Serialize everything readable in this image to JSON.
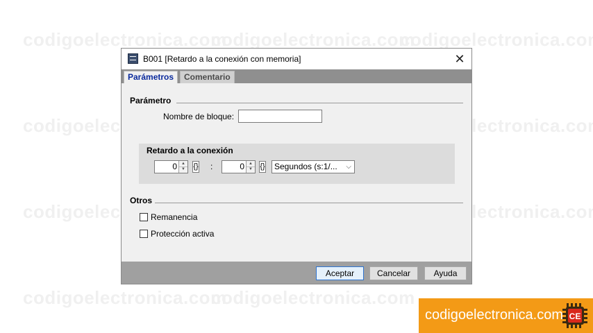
{
  "watermark_text": "codigoelectronica.com",
  "dialog": {
    "title": "B001 [Retardo a la conexión con memoria]",
    "close_glyph": "✕",
    "icon": "block-icon"
  },
  "tabs": [
    {
      "label": "Parámetros",
      "active": true
    },
    {
      "label": "Comentario",
      "active": false
    }
  ],
  "parametro": {
    "section_title": "Parámetro",
    "block_name_label": "Nombre de bloque:",
    "block_name_value": ""
  },
  "retardo": {
    "title": "Retardo a la conexión",
    "value1": "0",
    "unit1": "{}",
    "colon": ":",
    "value2": "0",
    "unit2": "{}",
    "timebase": "Segundos (s:1/..."
  },
  "otros": {
    "section_title": "Otros",
    "remanencia_label": "Remanencia",
    "remanencia_checked": false,
    "proteccion_label": "Protección activa",
    "proteccion_checked": false
  },
  "buttons": {
    "ok": "Aceptar",
    "cancel": "Cancelar",
    "help": "Ayuda"
  },
  "brand": {
    "text": "codigoelectronica.com",
    "logo_letters": "CE",
    "bg_color": "#f39a16"
  }
}
